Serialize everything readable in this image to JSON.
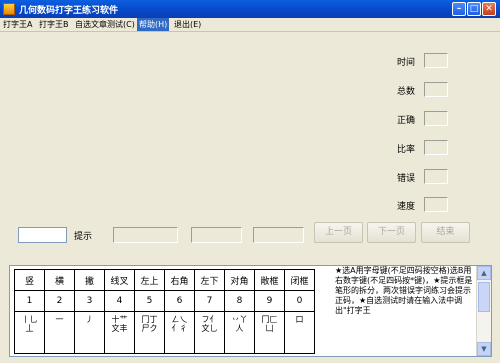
{
  "window": {
    "title": "几何数码打字王练习软件"
  },
  "menu": [
    {
      "label": "打字王A"
    },
    {
      "label": "打字王B"
    },
    {
      "label": "自选文章测试(C)"
    },
    {
      "label": "帮助(H)"
    },
    {
      "label": "退出(E)"
    }
  ],
  "stats": {
    "time_label": "时间",
    "total_label": "总数",
    "correct_label": "正确",
    "ratio_label": "比率",
    "error_label": "错误",
    "speed_label": "速度"
  },
  "hint_label": "提示",
  "buttons": {
    "prev": "上一页",
    "next": "下一页",
    "end": "结束"
  },
  "key_table": {
    "names": [
      "竖",
      "横",
      "撇",
      "线叉",
      "左上",
      "右角",
      "左下",
      "对角",
      "敞框",
      "闭框"
    ],
    "numbers": [
      "1",
      "2",
      "3",
      "4",
      "5",
      "6",
      "7",
      "8",
      "9",
      "0"
    ],
    "strokes": [
      "丨乚\n丄",
      "一",
      "丿",
      "十艹\n文丰",
      "冂丁\n尸ク",
      "ㄥ乀\n亻彳",
      "フ亻\n文乚",
      "丷丫\n人",
      "冂匚\n凵",
      "口"
    ]
  },
  "notes": "★选A用字母键(不足四码按空格)选B用右数字键(不足四码按*键)，★提示框是笔形的拆分，两次错误字词练习会提示正码，★自选测试时请在输入法中调出\"打字王"
}
